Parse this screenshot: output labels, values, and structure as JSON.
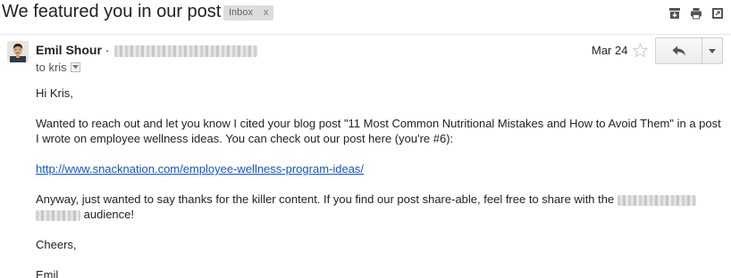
{
  "subject": "We featured you in our post",
  "label": {
    "text": "Inbox",
    "remove": "x"
  },
  "sender": {
    "name": "Emil Shour",
    "separator": "·"
  },
  "to_line": "to kris",
  "date": "Mar 24",
  "body": {
    "greeting": "Hi Kris,",
    "paragraph1": "Wanted to reach out and let you know I cited your blog post \"11 Most Common Nutritional Mistakes and How to Avoid Them\" in a post I wrote on employee wellness ideas. You can check out our post here (you're #6):",
    "link": "http://www.snacknation.com/employee-wellness-program-ideas/",
    "paragraph2_start": "Anyway, just wanted to say thanks for the killer content. If you find our post share-able, feel free to share with the",
    "paragraph2_end": "audience!",
    "closing": "Cheers,",
    "signature": "Emil"
  },
  "icons": {
    "archive": "archive-icon",
    "print": "print-icon",
    "newwindow": "new-window-icon",
    "star": "star-icon",
    "reply": "reply-icon",
    "more": "chevron-down-icon"
  },
  "colors": {
    "link": "#1155cc",
    "label_bg": "#dddddd",
    "star": "#cccccc"
  }
}
